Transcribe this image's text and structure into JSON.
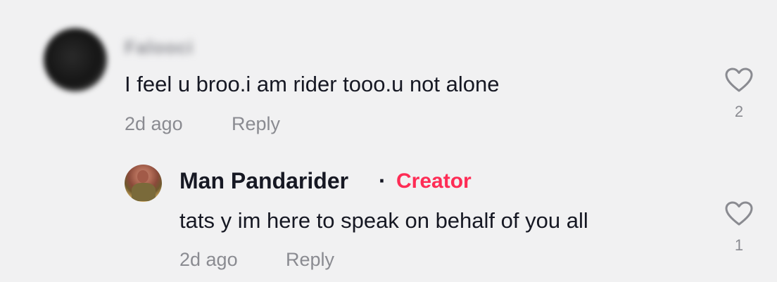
{
  "comments": [
    {
      "username": "Falooci",
      "text": "I feel u broo.i am rider tooo.u not alone",
      "time": "2d ago",
      "reply_label": "Reply",
      "like_count": "2",
      "like_icon": "heart-outline-icon"
    },
    {
      "username": "Man Pandarider",
      "separator": "·",
      "badge": "Creator",
      "text": "tats y im here to speak on behalf of you all",
      "time": "2d ago",
      "reply_label": "Reply",
      "like_count": "1",
      "like_icon": "heart-outline-icon"
    }
  ],
  "colors": {
    "background": "#f1f1f2",
    "text": "#161823",
    "muted": "#8a8b91",
    "creator_badge": "#fe2c55"
  }
}
